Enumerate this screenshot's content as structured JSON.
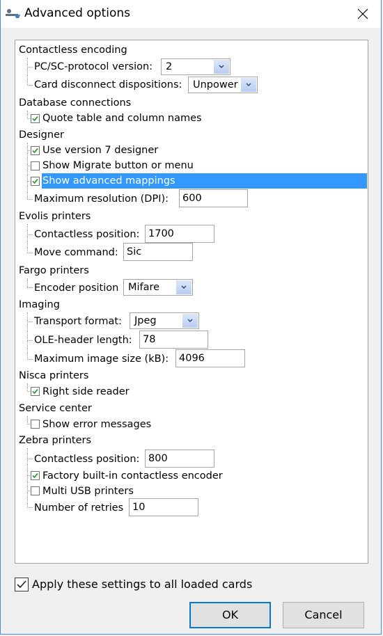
{
  "window": {
    "title": "Advanced options",
    "app_icon": "key-card-icon",
    "close_icon": "close-icon"
  },
  "settings": {
    "contactless_encoding": {
      "label": "Contactless encoding",
      "pcsc_protocol_label": "PC/SC-protocol version:",
      "pcsc_protocol_value": "2",
      "card_disconnect_label": "Card disconnect dispositions:",
      "card_disconnect_value": "Unpower"
    },
    "database_connections": {
      "label": "Database connections",
      "quote_names_label": "Quote table and column names",
      "quote_names_checked": true
    },
    "designer": {
      "label": "Designer",
      "use_v7_label": "Use version 7 designer",
      "use_v7_checked": true,
      "show_migrate_label": "Show Migrate button or menu",
      "show_migrate_checked": false,
      "show_advanced_label": "Show advanced mappings",
      "show_advanced_checked": true,
      "show_advanced_selected": true,
      "max_resolution_label": "Maximum resolution (DPI):",
      "max_resolution_value": "600"
    },
    "evolis_printers": {
      "label": "Evolis printers",
      "contactless_position_label": "Contactless position:",
      "contactless_position_value": "1700",
      "move_command_label": "Move command:",
      "move_command_value": "Sic"
    },
    "fargo_printers": {
      "label": "Fargo printers",
      "encoder_position_label": "Encoder position",
      "encoder_position_value": "Mifare"
    },
    "imaging": {
      "label": "Imaging",
      "transport_format_label": "Transport format:",
      "transport_format_value": "Jpeg",
      "ole_header_label": "OLE-header length:",
      "ole_header_value": "78",
      "max_image_size_label": "Maximum image size (kB):",
      "max_image_size_value": "4096"
    },
    "nisca_printers": {
      "label": "Nisca printers",
      "right_side_reader_label": "Right side reader",
      "right_side_reader_checked": true
    },
    "service_center": {
      "label": "Service center",
      "show_errors_label": "Show error messages",
      "show_errors_checked": false
    },
    "zebra_printers": {
      "label": "Zebra printers",
      "contactless_position_label": "Contactless position:",
      "contactless_position_value": "800",
      "factory_encoder_label": "Factory built-in contactless encoder",
      "factory_encoder_checked": true,
      "multi_usb_label": "Multi USB printers",
      "multi_usb_checked": false,
      "retries_label": "Number of retries",
      "retries_value": "10"
    }
  },
  "footer": {
    "apply_all_label": "Apply these settings to all loaded cards",
    "apply_all_checked": true,
    "ok_label": "OK",
    "cancel_label": "Cancel"
  },
  "colors": {
    "selection": "#3399ff",
    "focus_border": "#0078d7",
    "check_green": "#3a9a3a"
  }
}
